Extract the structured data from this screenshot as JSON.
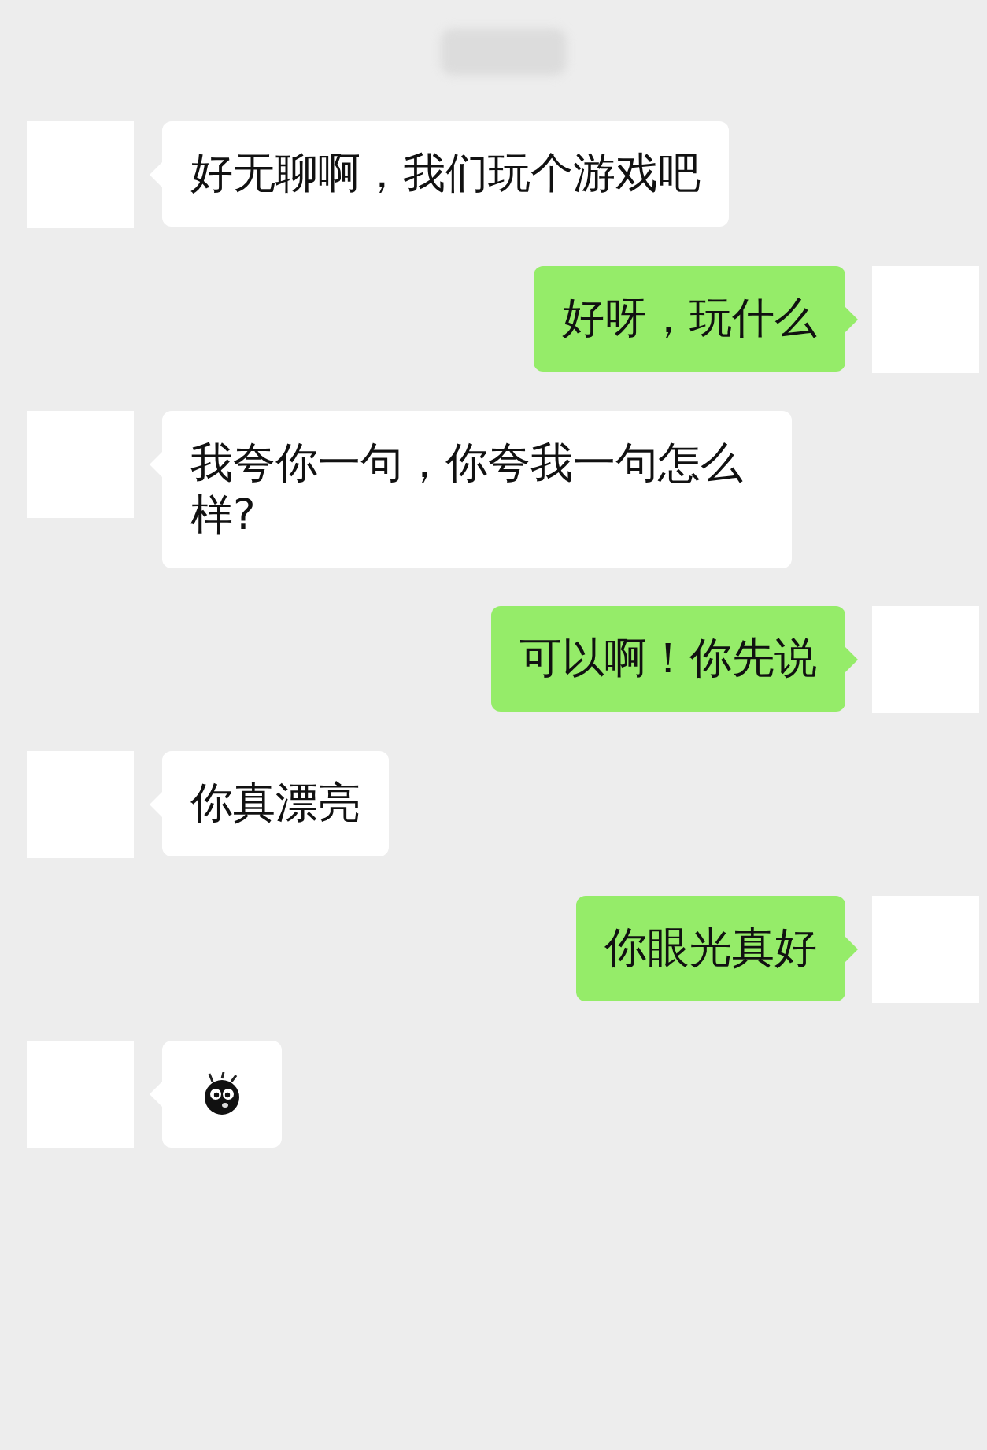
{
  "messages": [
    {
      "outgoing": false,
      "kind": "text",
      "text": "好无聊啊，我们玩个游戏吧"
    },
    {
      "outgoing": true,
      "kind": "text",
      "text": "好呀，玩什么"
    },
    {
      "outgoing": false,
      "kind": "text",
      "text": "我夸你一句，你夸我一句怎么样?"
    },
    {
      "outgoing": true,
      "kind": "text",
      "text": "可以啊！你先说"
    },
    {
      "outgoing": false,
      "kind": "text",
      "text": "你真漂亮"
    },
    {
      "outgoing": true,
      "kind": "text",
      "text": "你眼光真好"
    },
    {
      "outgoing": false,
      "kind": "sticker"
    }
  ]
}
